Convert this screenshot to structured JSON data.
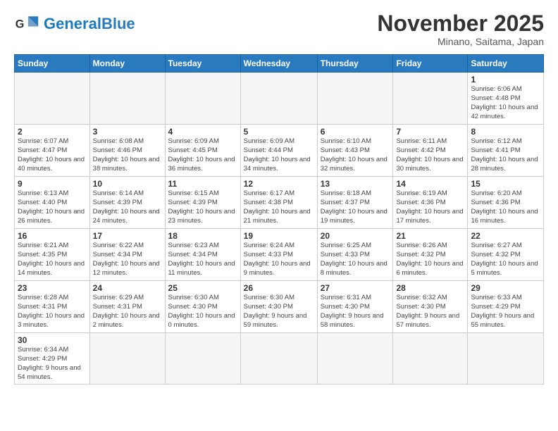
{
  "header": {
    "logo_general": "General",
    "logo_blue": "Blue",
    "month": "November 2025",
    "location": "Minano, Saitama, Japan"
  },
  "weekdays": [
    "Sunday",
    "Monday",
    "Tuesday",
    "Wednesday",
    "Thursday",
    "Friday",
    "Saturday"
  ],
  "weeks": [
    [
      {
        "day": "",
        "info": ""
      },
      {
        "day": "",
        "info": ""
      },
      {
        "day": "",
        "info": ""
      },
      {
        "day": "",
        "info": ""
      },
      {
        "day": "",
        "info": ""
      },
      {
        "day": "",
        "info": ""
      },
      {
        "day": "1",
        "info": "Sunrise: 6:06 AM\nSunset: 4:48 PM\nDaylight: 10 hours\nand 42 minutes."
      }
    ],
    [
      {
        "day": "2",
        "info": "Sunrise: 6:07 AM\nSunset: 4:47 PM\nDaylight: 10 hours\nand 40 minutes."
      },
      {
        "day": "3",
        "info": "Sunrise: 6:08 AM\nSunset: 4:46 PM\nDaylight: 10 hours\nand 38 minutes."
      },
      {
        "day": "4",
        "info": "Sunrise: 6:09 AM\nSunset: 4:45 PM\nDaylight: 10 hours\nand 36 minutes."
      },
      {
        "day": "5",
        "info": "Sunrise: 6:09 AM\nSunset: 4:44 PM\nDaylight: 10 hours\nand 34 minutes."
      },
      {
        "day": "6",
        "info": "Sunrise: 6:10 AM\nSunset: 4:43 PM\nDaylight: 10 hours\nand 32 minutes."
      },
      {
        "day": "7",
        "info": "Sunrise: 6:11 AM\nSunset: 4:42 PM\nDaylight: 10 hours\nand 30 minutes."
      },
      {
        "day": "8",
        "info": "Sunrise: 6:12 AM\nSunset: 4:41 PM\nDaylight: 10 hours\nand 28 minutes."
      }
    ],
    [
      {
        "day": "9",
        "info": "Sunrise: 6:13 AM\nSunset: 4:40 PM\nDaylight: 10 hours\nand 26 minutes."
      },
      {
        "day": "10",
        "info": "Sunrise: 6:14 AM\nSunset: 4:39 PM\nDaylight: 10 hours\nand 24 minutes."
      },
      {
        "day": "11",
        "info": "Sunrise: 6:15 AM\nSunset: 4:39 PM\nDaylight: 10 hours\nand 23 minutes."
      },
      {
        "day": "12",
        "info": "Sunrise: 6:17 AM\nSunset: 4:38 PM\nDaylight: 10 hours\nand 21 minutes."
      },
      {
        "day": "13",
        "info": "Sunrise: 6:18 AM\nSunset: 4:37 PM\nDaylight: 10 hours\nand 19 minutes."
      },
      {
        "day": "14",
        "info": "Sunrise: 6:19 AM\nSunset: 4:36 PM\nDaylight: 10 hours\nand 17 minutes."
      },
      {
        "day": "15",
        "info": "Sunrise: 6:20 AM\nSunset: 4:36 PM\nDaylight: 10 hours\nand 16 minutes."
      }
    ],
    [
      {
        "day": "16",
        "info": "Sunrise: 6:21 AM\nSunset: 4:35 PM\nDaylight: 10 hours\nand 14 minutes."
      },
      {
        "day": "17",
        "info": "Sunrise: 6:22 AM\nSunset: 4:34 PM\nDaylight: 10 hours\nand 12 minutes."
      },
      {
        "day": "18",
        "info": "Sunrise: 6:23 AM\nSunset: 4:34 PM\nDaylight: 10 hours\nand 11 minutes."
      },
      {
        "day": "19",
        "info": "Sunrise: 6:24 AM\nSunset: 4:33 PM\nDaylight: 10 hours\nand 9 minutes."
      },
      {
        "day": "20",
        "info": "Sunrise: 6:25 AM\nSunset: 4:33 PM\nDaylight: 10 hours\nand 8 minutes."
      },
      {
        "day": "21",
        "info": "Sunrise: 6:26 AM\nSunset: 4:32 PM\nDaylight: 10 hours\nand 6 minutes."
      },
      {
        "day": "22",
        "info": "Sunrise: 6:27 AM\nSunset: 4:32 PM\nDaylight: 10 hours\nand 5 minutes."
      }
    ],
    [
      {
        "day": "23",
        "info": "Sunrise: 6:28 AM\nSunset: 4:31 PM\nDaylight: 10 hours\nand 3 minutes."
      },
      {
        "day": "24",
        "info": "Sunrise: 6:29 AM\nSunset: 4:31 PM\nDaylight: 10 hours\nand 2 minutes."
      },
      {
        "day": "25",
        "info": "Sunrise: 6:30 AM\nSunset: 4:30 PM\nDaylight: 10 hours\nand 0 minutes."
      },
      {
        "day": "26",
        "info": "Sunrise: 6:30 AM\nSunset: 4:30 PM\nDaylight: 9 hours\nand 59 minutes."
      },
      {
        "day": "27",
        "info": "Sunrise: 6:31 AM\nSunset: 4:30 PM\nDaylight: 9 hours\nand 58 minutes."
      },
      {
        "day": "28",
        "info": "Sunrise: 6:32 AM\nSunset: 4:30 PM\nDaylight: 9 hours\nand 57 minutes."
      },
      {
        "day": "29",
        "info": "Sunrise: 6:33 AM\nSunset: 4:29 PM\nDaylight: 9 hours\nand 55 minutes."
      }
    ],
    [
      {
        "day": "30",
        "info": "Sunrise: 6:34 AM\nSunset: 4:29 PM\nDaylight: 9 hours\nand 54 minutes."
      },
      {
        "day": "",
        "info": ""
      },
      {
        "day": "",
        "info": ""
      },
      {
        "day": "",
        "info": ""
      },
      {
        "day": "",
        "info": ""
      },
      {
        "day": "",
        "info": ""
      },
      {
        "day": "",
        "info": ""
      }
    ]
  ]
}
